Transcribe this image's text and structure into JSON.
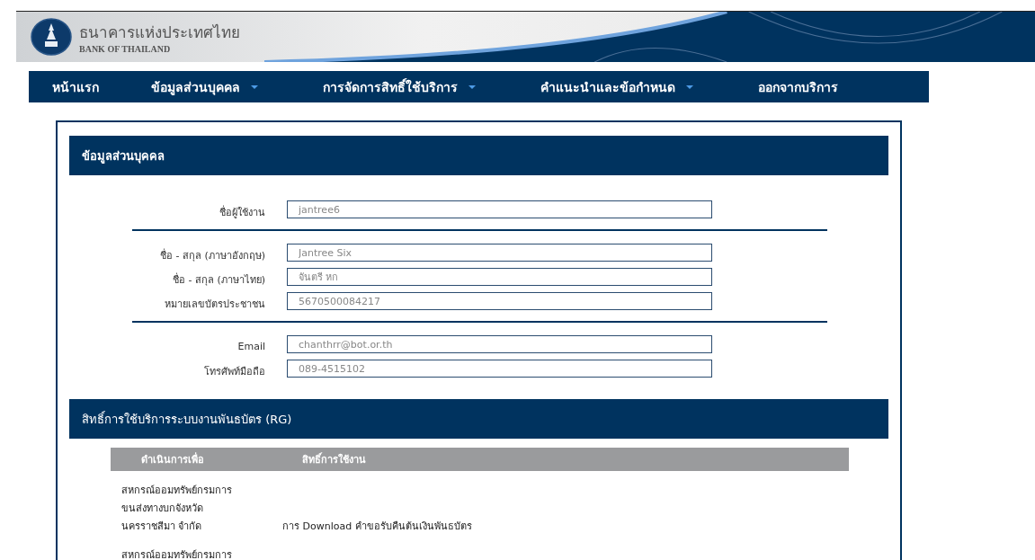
{
  "header": {
    "title_thai": "ธนาคารแห่งประเทศไทย",
    "title_english": "BANK OF THAILAND"
  },
  "nav": [
    {
      "label": "หน้าแรก",
      "has_dropdown": false
    },
    {
      "label": "ข้อมูลส่วนบุคคล",
      "has_dropdown": true
    },
    {
      "label": "การจัดการสิทธิ์ใช้บริการ",
      "has_dropdown": true
    },
    {
      "label": "คำแนะนำและข้อกำหนด",
      "has_dropdown": true
    },
    {
      "label": "ออกจากบริการ",
      "has_dropdown": false
    }
  ],
  "profile": {
    "title": "ข้อมูลส่วนบุคคล",
    "groups": [
      [
        {
          "label": "ชื่อผู้ใช้งาน",
          "value": "jantree6"
        }
      ],
      [
        {
          "label": "ชื่อ - สกุล (ภาษาอังกฤษ)",
          "value": "Jantree Six"
        },
        {
          "label": "ชื่อ - สกุล (ภาษาไทย)",
          "value": "จันตรี หก"
        },
        {
          "label": "หมายเลขบัตรประชาชน",
          "value": "5670500084217"
        }
      ],
      [
        {
          "label": "Email",
          "value": "chanthrr@bot.or.th"
        },
        {
          "label": "โทรศัพท์มือถือ",
          "value": "089-4515102"
        }
      ]
    ]
  },
  "rights": {
    "title": "สิทธิ์การใช้บริการระบบงานพันธบัตร (RG)",
    "columns": [
      "ดำเนินการเพื่อ",
      "สิทธิ์การใช้งาน"
    ],
    "rows": [
      {
        "organization": "สหกรณ์ออมทรัพย์กรมการขนส่งทางบกจังหวัดนครราชสีมา จำกัด",
        "right": "การ Download คำขอรับคืนต้นเงินพันธบัตร"
      },
      {
        "organization": "สหกรณ์ออมทรัพย์กรมการ",
        "right": ""
      }
    ]
  }
}
